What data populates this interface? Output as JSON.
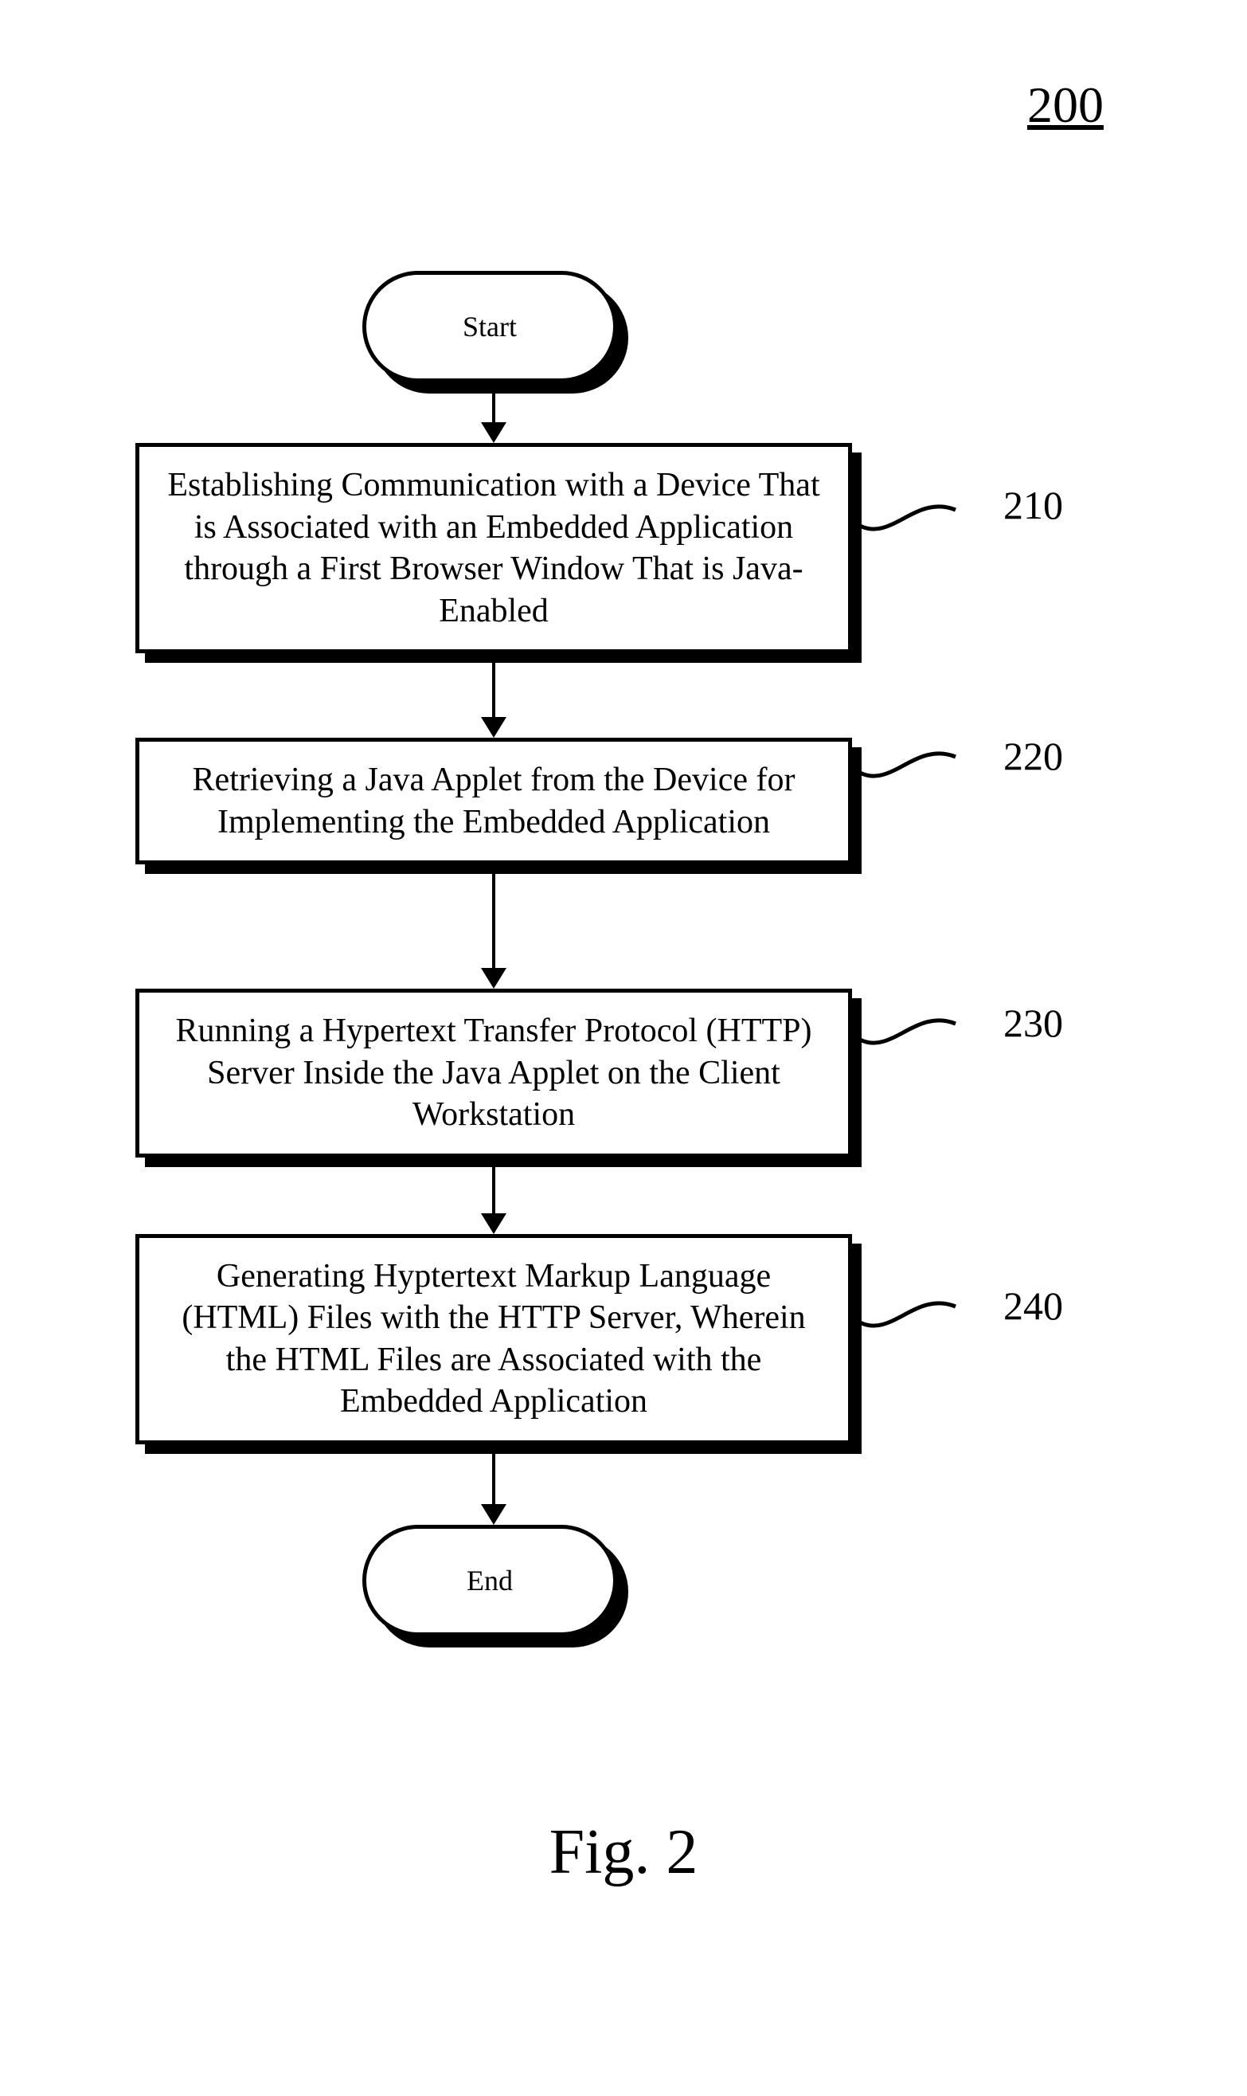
{
  "figure_number": "200",
  "caption": "Fig. 2",
  "terminators": {
    "start": "Start",
    "end": "End"
  },
  "steps": [
    {
      "ref": "210",
      "text": "Establishing Communication with a Device That is Associated with an Embedded Application through a First Browser Window That is Java-Enabled"
    },
    {
      "ref": "220",
      "text": "Retrieving a Java Applet from the Device for Implementing the Embedded Application"
    },
    {
      "ref": "230",
      "text": "Running a Hypertext Transfer Protocol (HTTP) Server Inside the Java Applet on the Client Workstation"
    },
    {
      "ref": "240",
      "text": "Generating Hyptertext Markup Language (HTML) Files with the HTTP Server, Wherein the HTML Files are Associated with the Embedded Application"
    }
  ]
}
